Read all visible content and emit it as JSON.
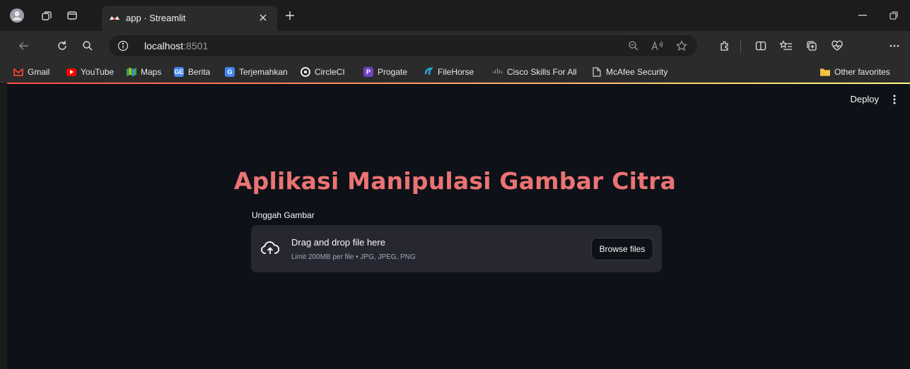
{
  "browser": {
    "tab": {
      "title": "app · Streamlit"
    },
    "url": {
      "host": "localhost",
      "port": ":8501"
    },
    "bookmarks": [
      {
        "label": "Gmail",
        "icon": "gmail-icon",
        "color": "#ea4335"
      },
      {
        "label": "YouTube",
        "icon": "youtube-icon",
        "color": "#ff0000"
      },
      {
        "label": "Maps",
        "icon": "maps-icon",
        "color": "#34a853"
      },
      {
        "label": "Berita",
        "icon": "news-icon",
        "color": "#4285f4"
      },
      {
        "label": "Terjemahkan",
        "icon": "translate-icon",
        "color": "#4285f4"
      },
      {
        "label": "CircleCI",
        "icon": "circleci-icon",
        "color": "#ffffff"
      },
      {
        "label": "Progate",
        "icon": "progate-icon",
        "color": "#6f42c1"
      },
      {
        "label": "FileHorse",
        "icon": "filehorse-icon",
        "color": "#29a8e0"
      },
      {
        "label": "Cisco Skills For All",
        "icon": "cisco-icon",
        "color": "#888888"
      },
      {
        "label": "McAfee Security",
        "icon": "page-icon",
        "color": "#cccccc"
      }
    ],
    "other_favorites": "Other favorites"
  },
  "app": {
    "deploy_label": "Deploy",
    "title": "Aplikasi Manipulasi Gambar Citra",
    "uploader": {
      "label": "Unggah Gambar",
      "drag_text": "Drag and drop file here",
      "limit_text": "Limit 200MB per file • JPG, JPEG, PNG",
      "browse_label": "Browse files"
    }
  }
}
